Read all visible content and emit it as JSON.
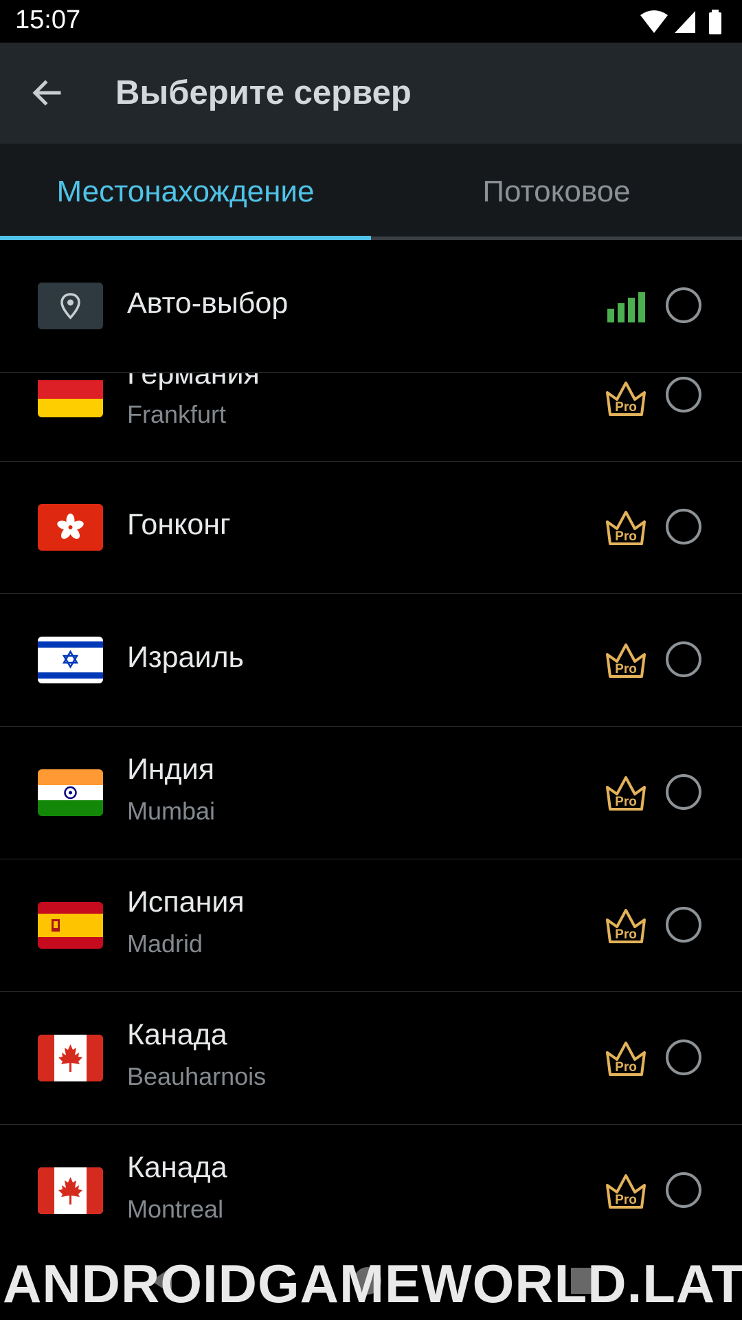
{
  "status_bar": {
    "time": "15:07",
    "icons": [
      "wifi-icon",
      "cell-signal-icon",
      "battery-icon"
    ]
  },
  "app_bar": {
    "title": "Выберите сервер",
    "back_icon": "arrow-left-icon"
  },
  "tabs": [
    {
      "label": "Местонахождение",
      "selected": true
    },
    {
      "label": "Потоковое",
      "selected": false
    }
  ],
  "auto_select": {
    "label": "Авто-выбор",
    "icon": "location-pin-icon",
    "signal_icon": "signal-bars-icon",
    "selected": false
  },
  "servers": [
    {
      "country": "Германия",
      "city": "Frankfurt",
      "flag": "germany-flag",
      "pro": true,
      "selected": false
    },
    {
      "country": "Гонконг",
      "city": "",
      "flag": "hong-kong-flag",
      "pro": true,
      "selected": false
    },
    {
      "country": "Израиль",
      "city": "",
      "flag": "israel-flag",
      "pro": true,
      "selected": false
    },
    {
      "country": "Индия",
      "city": "Mumbai",
      "flag": "india-flag",
      "pro": true,
      "selected": false
    },
    {
      "country": "Испания",
      "city": "Madrid",
      "flag": "spain-flag",
      "pro": true,
      "selected": false
    },
    {
      "country": "Канада",
      "city": "Beauharnois",
      "flag": "canada-flag",
      "pro": true,
      "selected": false
    },
    {
      "country": "Канада",
      "city": "Montreal",
      "flag": "canada-flag",
      "pro": true,
      "selected": false
    }
  ],
  "pro_badge_text": "Pro",
  "colors": {
    "accent": "#4fc3e8",
    "pro_gold": "#e3b25a",
    "signal_green": "#4caf50",
    "app_bar": "#22272b",
    "background": "#000000"
  },
  "watermark": "ANDROIDGAMEWORLD.LAT"
}
